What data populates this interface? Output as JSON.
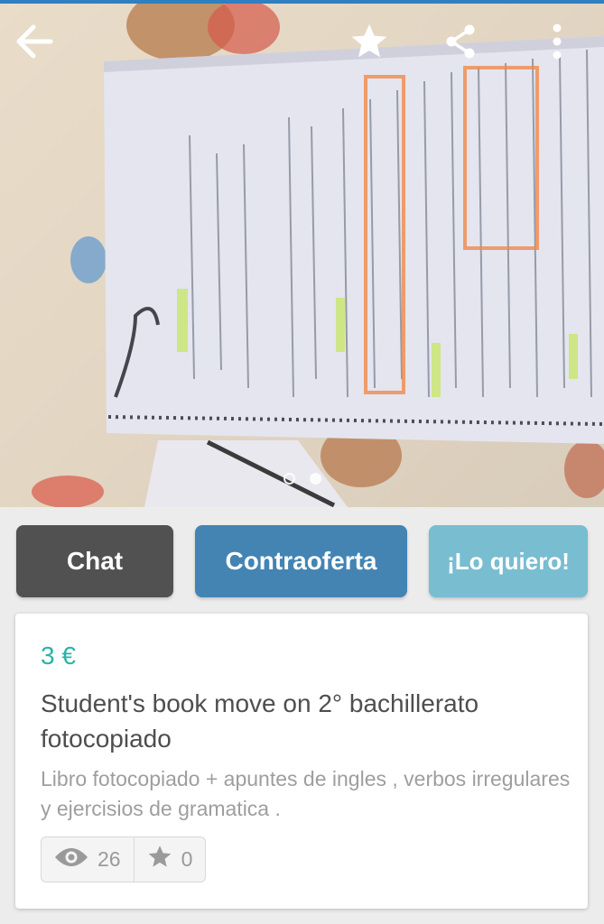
{
  "photo": {
    "gallery_count": 2,
    "active_index": 1
  },
  "appbar": {
    "back_icon": "arrow-left-icon",
    "favorite_icon": "star-icon",
    "share_icon": "share-icon",
    "menu_icon": "more-vertical-icon"
  },
  "actions": {
    "chat_label": "Chat",
    "offer_label": "Contraoferta",
    "want_label": "¡Lo quiero!"
  },
  "product": {
    "price": "3 €",
    "title": "Student's book move on 2° bachillerato fotocopiado",
    "description": "Libro fotocopiado + apuntes de ingles , verbos irregulares y ejercisios de gramatica .",
    "views": "26",
    "favorites": "0"
  },
  "colors": {
    "accent_price": "#2ab3a6",
    "chat_button": "#515151",
    "offer_button": "#4384b3",
    "want_button": "#79bdd1"
  }
}
